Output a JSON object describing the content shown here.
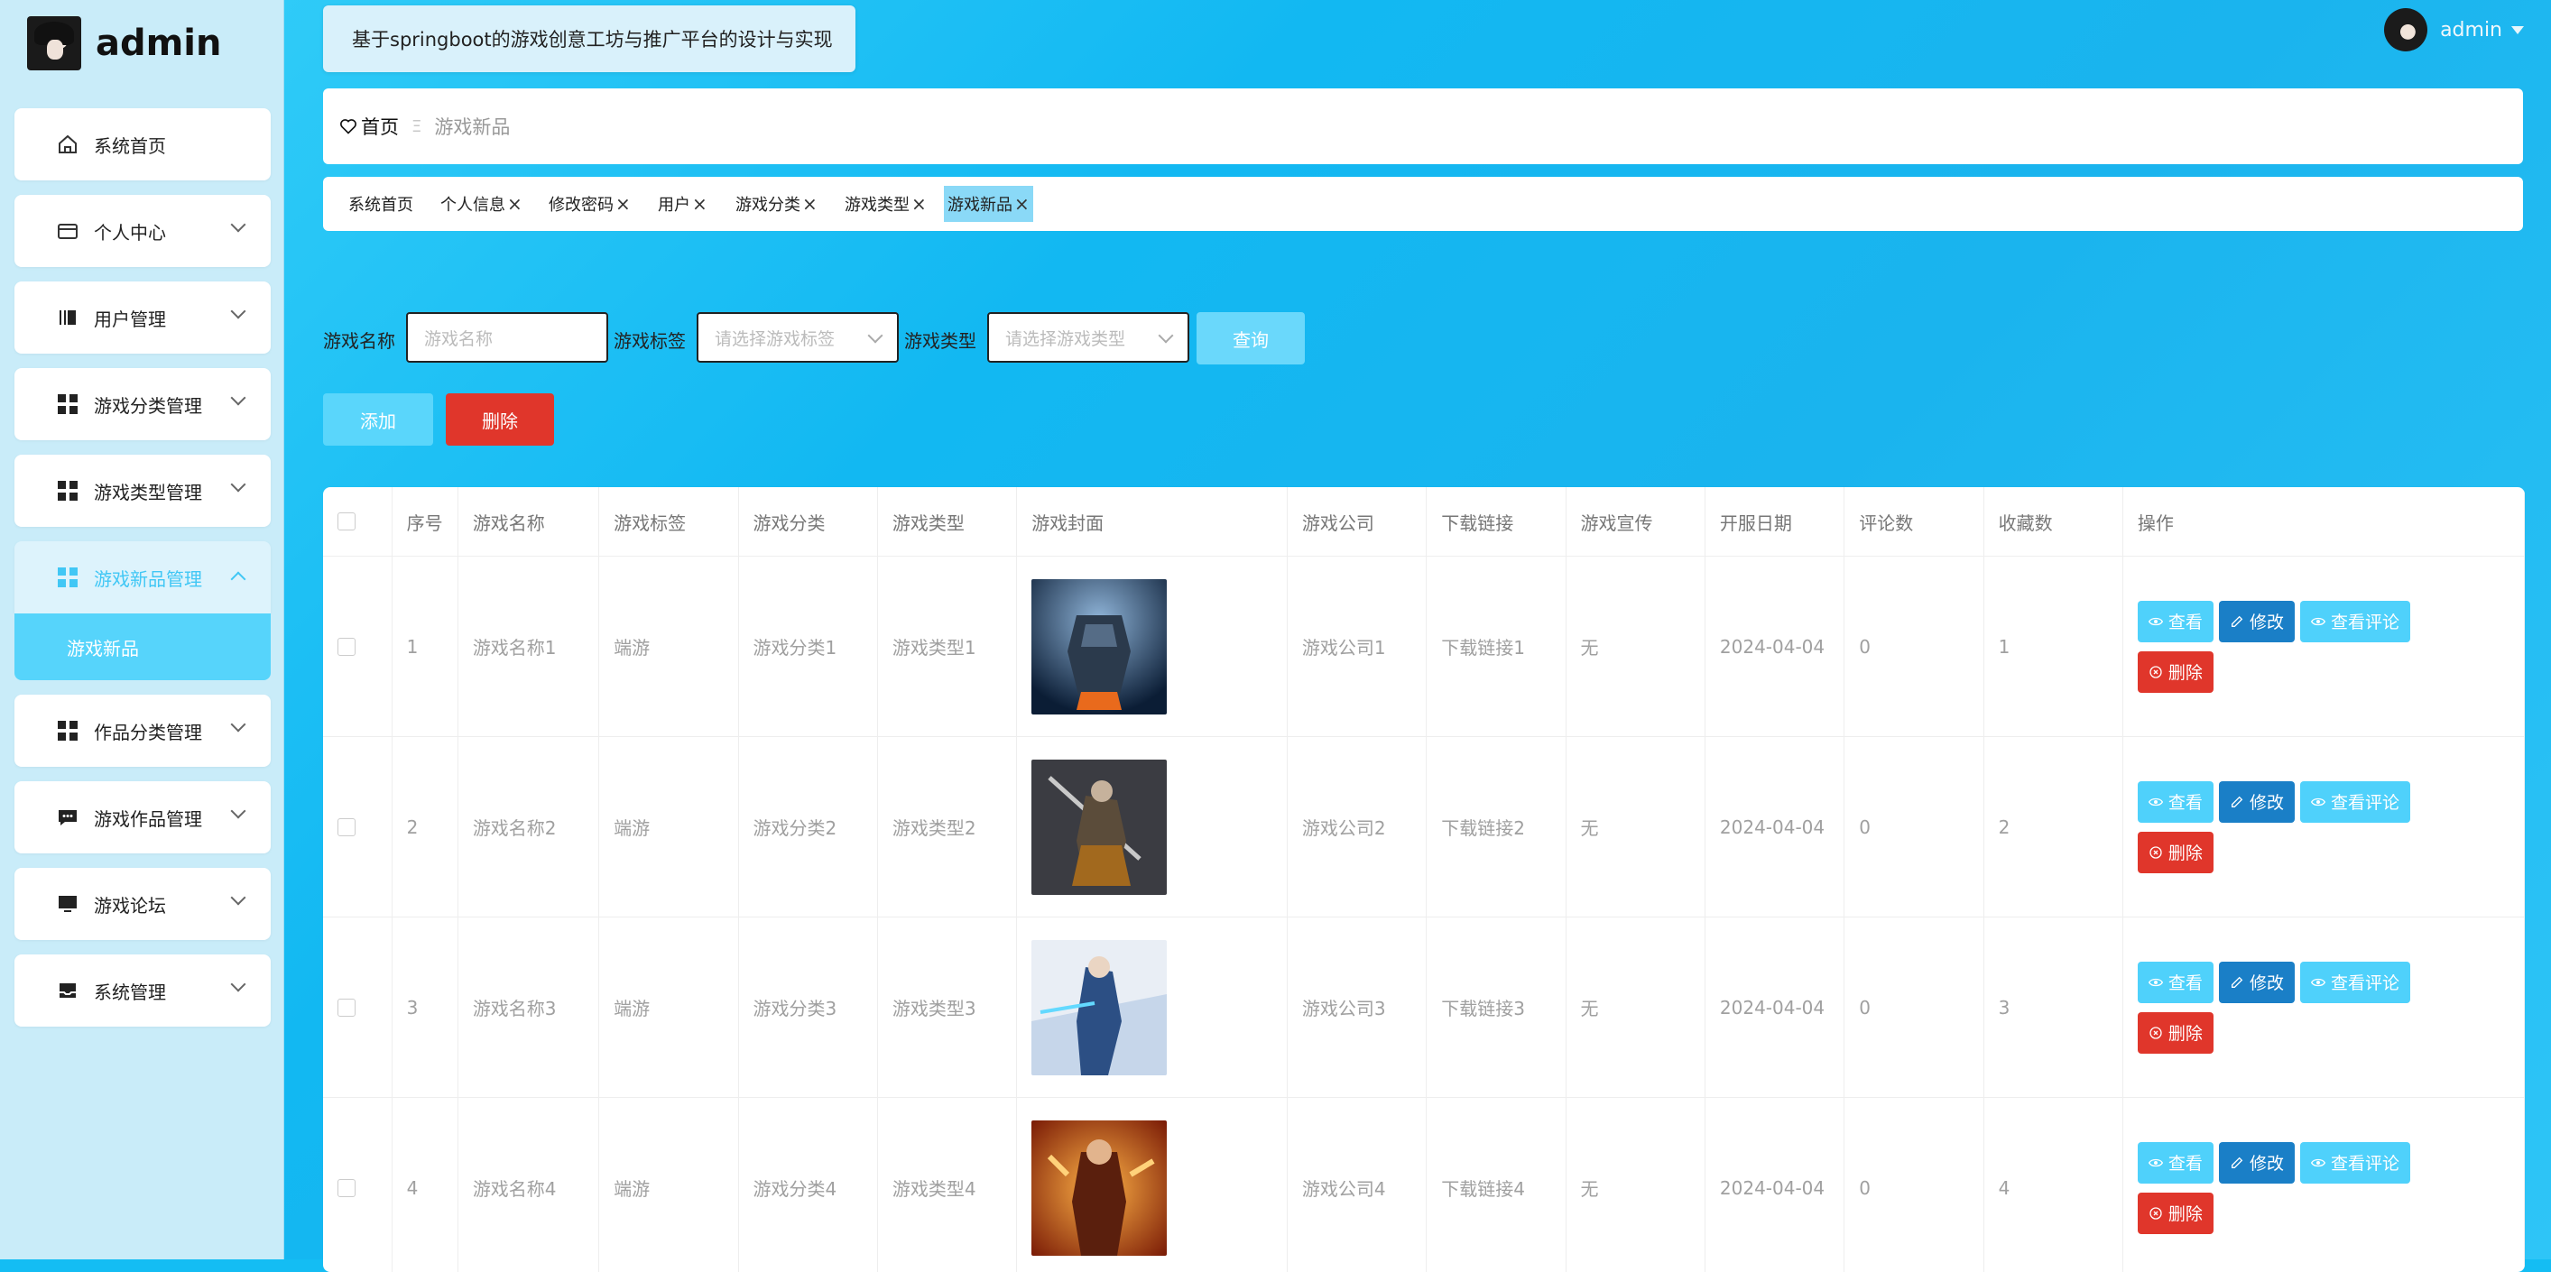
{
  "sidebar": {
    "brand": "admin",
    "items": [
      {
        "label": "系统首页",
        "icon": "home-icon"
      },
      {
        "label": "个人中心",
        "icon": "wallet-icon"
      },
      {
        "label": "用户管理",
        "icon": "book-icon"
      },
      {
        "label": "游戏分类管理",
        "icon": "grid-icon"
      },
      {
        "label": "游戏类型管理",
        "icon": "grid-icon"
      },
      {
        "label": "游戏新品管理",
        "icon": "grid-icon",
        "expanded": true
      },
      {
        "label": "作品分类管理",
        "icon": "grid-icon"
      },
      {
        "label": "游戏作品管理",
        "icon": "chat-icon"
      },
      {
        "label": "游戏论坛",
        "icon": "monitor-icon"
      },
      {
        "label": "系统管理",
        "icon": "inbox-icon"
      }
    ],
    "sub_item": "游戏新品"
  },
  "header": {
    "title": "基于springboot的游戏创意工坊与推广平台的设计与实现",
    "user": "admin"
  },
  "breadcrumb": {
    "home": "首页",
    "separator": "Ξ",
    "current": "游戏新品"
  },
  "tags": [
    "系统首页",
    "个人信息",
    "修改密码",
    "用户",
    "游戏分类",
    "游戏类型",
    "游戏新品"
  ],
  "search": {
    "name_label": "游戏名称",
    "name_placeholder": "游戏名称",
    "tag_label": "游戏标签",
    "tag_placeholder": "请选择游戏标签",
    "type_label": "游戏类型",
    "type_placeholder": "请选择游戏类型",
    "query_button": "查询"
  },
  "actions": {
    "add": "添加",
    "delete": "删除"
  },
  "table": {
    "headers": [
      "序号",
      "游戏名称",
      "游戏标签",
      "游戏分类",
      "游戏类型",
      "游戏封面",
      "游戏公司",
      "下载链接",
      "游戏宣传",
      "开服日期",
      "评论数",
      "收藏数",
      "操作"
    ],
    "rows": [
      {
        "index": "1",
        "name": "游戏名称1",
        "tag": "端游",
        "category": "游戏分类1",
        "type": "游戏类型1",
        "company": "游戏公司1",
        "link": "下载链接1",
        "promo": "无",
        "date": "2024-04-04",
        "comments": "0",
        "favorites": "1"
      },
      {
        "index": "2",
        "name": "游戏名称2",
        "tag": "端游",
        "category": "游戏分类2",
        "type": "游戏类型2",
        "company": "游戏公司2",
        "link": "下载链接2",
        "promo": "无",
        "date": "2024-04-04",
        "comments": "0",
        "favorites": "2"
      },
      {
        "index": "3",
        "name": "游戏名称3",
        "tag": "端游",
        "category": "游戏分类3",
        "type": "游戏类型3",
        "company": "游戏公司3",
        "link": "下载链接3",
        "promo": "无",
        "date": "2024-04-04",
        "comments": "0",
        "favorites": "3"
      },
      {
        "index": "4",
        "name": "游戏名称4",
        "tag": "端游",
        "category": "游戏分类4",
        "type": "游戏类型4",
        "company": "游戏公司4",
        "link": "下载链接4",
        "promo": "无",
        "date": "2024-04-04",
        "comments": "0",
        "favorites": "4"
      }
    ],
    "op_labels": {
      "view": "查看",
      "edit": "修改",
      "comments": "查看评论",
      "delete": "删除"
    }
  },
  "colors": {
    "accent": "#4fd1fb",
    "edit": "#1a7fc7",
    "danger": "#e0362b",
    "sidebar_bg": "#c9ecf9"
  }
}
